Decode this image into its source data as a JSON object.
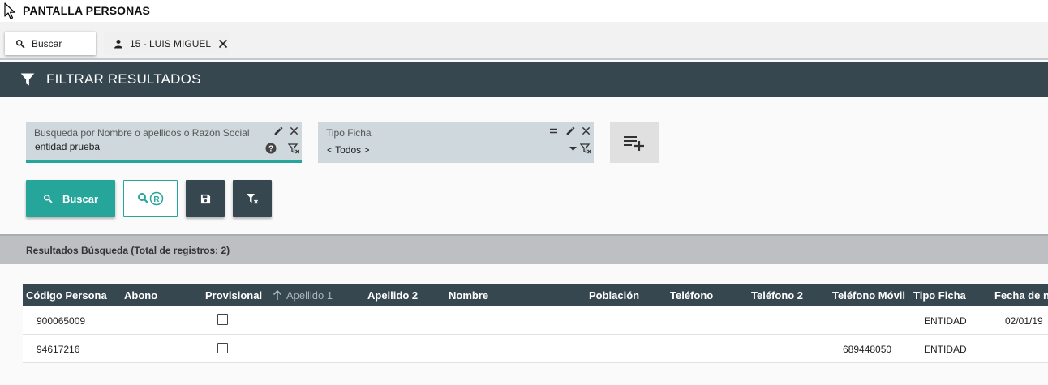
{
  "app": {
    "title": "PANTALLA PERSONAS"
  },
  "tabs": [
    {
      "label": "Buscar",
      "icon": "search-icon"
    },
    {
      "label": "15 - LUIS MIGUEL",
      "icon": "person-icon",
      "closable": true
    }
  ],
  "filter": {
    "header": "FILTRAR RESULTADOS",
    "fields": [
      {
        "label": "Busqueda por Nombre o apellidos o Razón Social",
        "value": "entidad prueba",
        "icons": [
          "edit-icon",
          "close-icon",
          "help-icon",
          "filter-clear-icon"
        ]
      },
      {
        "label": "Tipo Ficha",
        "value": "< Todos >",
        "icons": [
          "equals-icon",
          "edit-icon",
          "close-icon",
          "dropdown-icon",
          "filter-clear-icon"
        ]
      }
    ],
    "add_filter_icon": "playlist-add-icon"
  },
  "actions": {
    "search_label": "Buscar",
    "advanced_icon": "search-registered-icon",
    "save_icon": "save-icon",
    "clear_icon": "filter-clear-icon"
  },
  "results": {
    "title": "Resultados Búsqueda (Total de registros: 2)",
    "columns": [
      "Código Persona",
      "Abono",
      "Provisional",
      "Apellido 1",
      "Apellido 2",
      "Nombre",
      "Población",
      "Teléfono",
      "Teléfono 2",
      "Teléfono Móvil",
      "Tipo Ficha",
      "Fecha de na"
    ],
    "sorted_column": "Apellido 1",
    "rows": [
      {
        "codigo": "900065009",
        "abono": "",
        "provisional": false,
        "apellido1": "",
        "apellido2": "",
        "nombre": "",
        "poblacion": "",
        "telefono": "",
        "telefono2": "",
        "movil": "",
        "tipo": "ENTIDAD",
        "fecha": "02/01/19"
      },
      {
        "codigo": "94617216",
        "abono": "",
        "provisional": false,
        "apellido1": "",
        "apellido2": "",
        "nombre": "",
        "poblacion": "",
        "telefono": "",
        "telefono2": "",
        "movil": "689448050",
        "tipo": "ENTIDAD",
        "fecha": ""
      }
    ]
  },
  "colors": {
    "header_dark": "#36474f",
    "accent_teal": "#26a69a",
    "field_bg": "#cfd8dc"
  }
}
